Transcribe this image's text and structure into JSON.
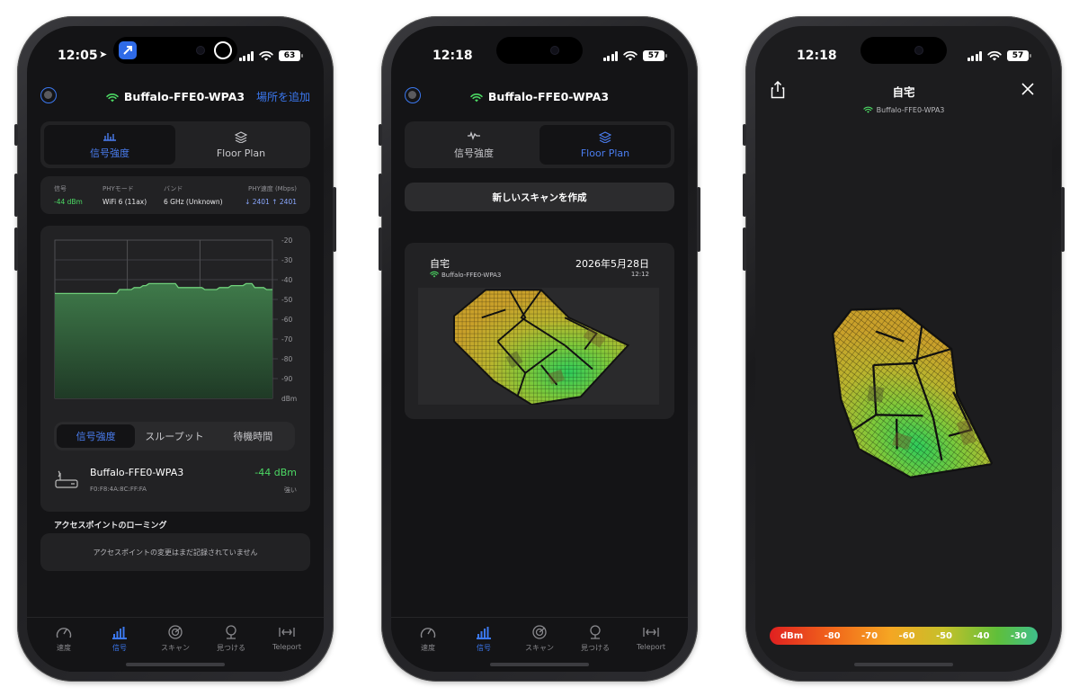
{
  "colors": {
    "accent": "#3b78f0",
    "signal_green": "#4cd964",
    "bg": "#141416",
    "card": "#222224"
  },
  "phone1": {
    "status": {
      "time": "12:05",
      "battery": "63"
    },
    "ssid": "Buffalo-FFE0-WPA3",
    "add_location": "場所を追加",
    "segment": [
      {
        "label": "信号強度",
        "icon": "signal-strength-icon",
        "active": true
      },
      {
        "label": "Floor Plan",
        "icon": "layers-icon",
        "active": false
      }
    ],
    "info": {
      "signal_label": "信号",
      "signal_value": "-44 dBm",
      "phy_mode_label": "PHYモード",
      "phy_mode_value": "WiFi 6 (11ax)",
      "band_label": "バンド",
      "band_value": "6 GHz (Unknown)",
      "phy_rate_label": "PHY速度 (Mbps)",
      "phy_rate_down": "↓ 2401",
      "phy_rate_up": "↑ 2401"
    },
    "chart_data": {
      "type": "area",
      "yticks": [
        "-20",
        "-30",
        "-40",
        "-50",
        "-60",
        "-70",
        "-80",
        "-90",
        "dBm"
      ],
      "ylim": [
        -100,
        -20
      ],
      "values": [
        -47,
        -47,
        -47,
        -47,
        -47,
        -47,
        -47,
        -47,
        -47,
        -47,
        -47,
        -47,
        -47,
        -47,
        -47,
        -47,
        -47,
        -47,
        -47,
        -47,
        -47,
        -47,
        -45,
        -45,
        -45,
        -45,
        -45,
        -44,
        -44,
        -44,
        -43,
        -43,
        -42,
        -42,
        -42,
        -42,
        -42,
        -42,
        -42,
        -42,
        -42,
        -42,
        -44,
        -44,
        -44,
        -44,
        -44,
        -44,
        -44,
        -44,
        -44,
        -45,
        -45,
        -45,
        -45,
        -45,
        -44,
        -44,
        -44,
        -44,
        -43,
        -43,
        -43,
        -43,
        -43,
        -42,
        -42,
        -42,
        -44,
        -44,
        -44,
        -44,
        -45,
        -45,
        -45
      ]
    },
    "subtabs": [
      {
        "label": "信号強度",
        "active": true
      },
      {
        "label": "スループット",
        "active": false
      },
      {
        "label": "待機時間",
        "active": false
      }
    ],
    "ap": {
      "name": "Buffalo-FFE0-WPA3",
      "mac": "F0:F8:4A:8C:FF:FA",
      "dbm": "-44 dBm",
      "quality": "強い"
    },
    "roaming_title": "アクセスポイントのローミング",
    "roaming_empty": "アクセスポイントの変更はまだ記録されていません"
  },
  "phone2": {
    "status": {
      "time": "12:18",
      "battery": "57"
    },
    "ssid": "Buffalo-FFE0-WPA3",
    "segment": [
      {
        "label": "信号強度",
        "icon": "signal-strength-icon",
        "active": false
      },
      {
        "label": "Floor Plan",
        "icon": "layers-icon",
        "active": true
      }
    ],
    "new_scan": "新しいスキャンを作成",
    "scan": {
      "name": "自宅",
      "ssid": "Buffalo-FFE0-WPA3",
      "date": "2026年5月28日",
      "time": "12:12"
    }
  },
  "phone3": {
    "status": {
      "time": "12:18",
      "battery": "57"
    },
    "title": "自宅",
    "ssid": "Buffalo-FFE0-WPA3",
    "legend": [
      "dBm",
      "-80",
      "-70",
      "-60",
      "-50",
      "-40",
      "-30"
    ]
  },
  "tabbar": [
    {
      "label": "速度",
      "icon": "speedometer-icon"
    },
    {
      "label": "信号",
      "icon": "signal-bars-icon",
      "active": true
    },
    {
      "label": "スキャン",
      "icon": "radar-icon"
    },
    {
      "label": "見つける",
      "icon": "find-device-icon"
    },
    {
      "label": "Teleport",
      "icon": "teleport-icon"
    }
  ]
}
